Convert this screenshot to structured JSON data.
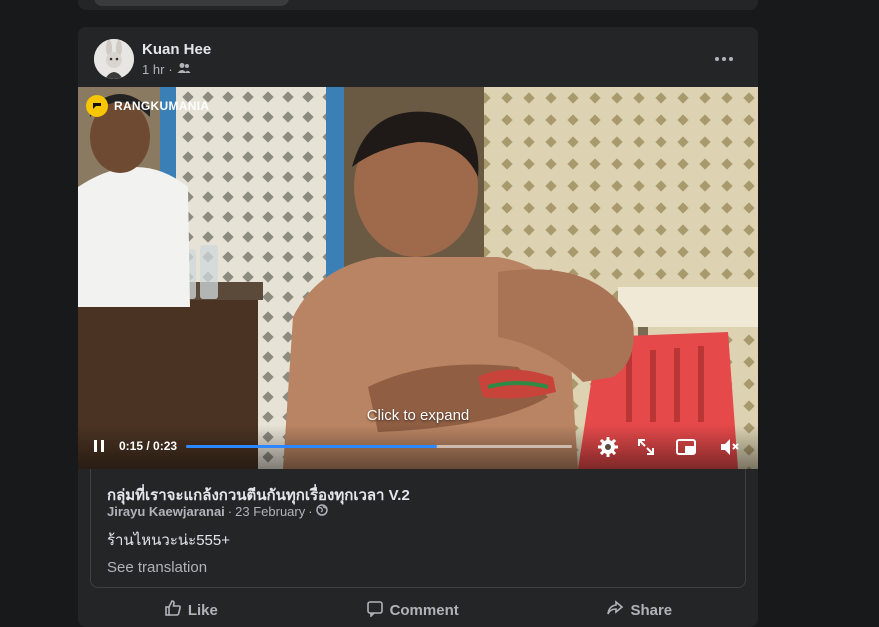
{
  "post": {
    "author": "Kuan Hee",
    "time": "1 hr",
    "meta_separator": "·",
    "audience_icon": "friends-icon",
    "more_icon": "more-dots-icon"
  },
  "video": {
    "watermark": "RANGKUMANIA",
    "center_text": "Click to expand",
    "time": "0:15 / 0:23",
    "progress": 0.65,
    "accent_color": "#2d88ff",
    "icons": [
      "pause-icon",
      "settings-icon",
      "fullscreen-icon",
      "picture-in-picture-icon",
      "mute-icon"
    ]
  },
  "shared": {
    "group_name": "กลุ่มที่เราจะแกล้งกวนตีนกันทุกเรื่องทุกเวลา V.2",
    "author": "Jirayu Kaewjaranai",
    "date": "23 February",
    "separator": "·",
    "audience_icon": "globe-icon",
    "text": "ร้านไหนวะน่ะ555+",
    "see_translation": "See translation"
  },
  "actions": {
    "like": "Like",
    "comment": "Comment",
    "share": "Share"
  }
}
